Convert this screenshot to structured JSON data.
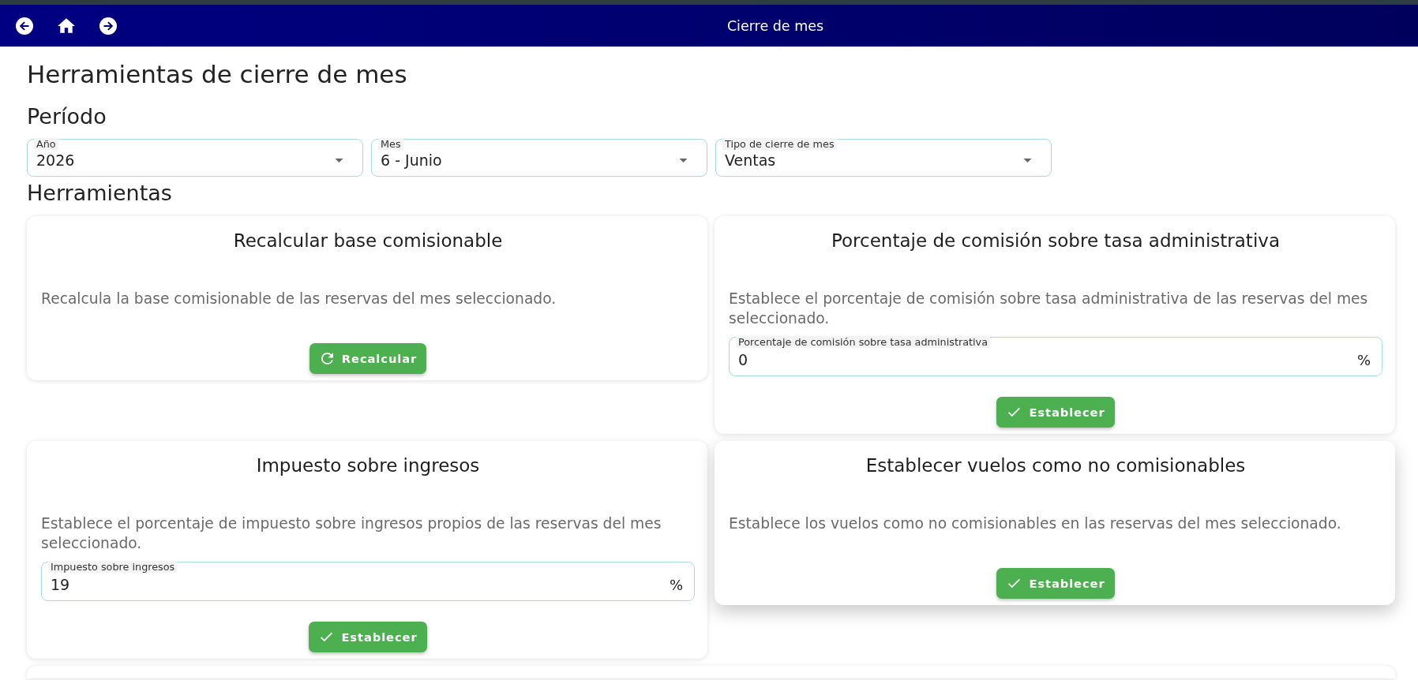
{
  "top_bar": {
    "title": "Cierre de mes"
  },
  "page_title": "Herramientas de cierre de mes",
  "period": {
    "title": "Período",
    "fields": [
      {
        "label": "Año",
        "value": "2026"
      },
      {
        "label": "Mes",
        "value": "6 - Junio"
      },
      {
        "label": "Tipo de cierre de mes",
        "value": "Ventas"
      }
    ]
  },
  "tools": {
    "title": "Herramientas",
    "cards": [
      {
        "title": "Recalcular base comisionable",
        "description": "Recalcula la base comisionable de las reservas del mes seleccionado.",
        "hovered": false,
        "button": {
          "label": "Recalcular",
          "kind": "recalculate"
        }
      },
      {
        "title": "Porcentaje de comisión sobre tasa administrativa",
        "description": "Establece el porcentaje de comisión sobre tasa administrativa de las reservas del mes seleccionado.",
        "hovered": false,
        "field": {
          "label": "Porcentaje de comisión sobre tasa administrativa",
          "value": "0",
          "suffix": "%"
        },
        "button": {
          "label": "Establecer",
          "kind": "apply"
        }
      },
      {
        "title": "Impuesto sobre ingresos",
        "description": "Establece el porcentaje de impuesto sobre ingresos propios de las reservas del mes seleccionado.",
        "hovered": false,
        "field": {
          "label": "Impuesto sobre ingresos",
          "value": "19",
          "suffix": "%"
        },
        "button": {
          "label": "Establecer",
          "kind": "apply"
        }
      },
      {
        "title": "Establecer vuelos como no comisionables",
        "description": "Establece los vuelos como no comisionables en las reservas del mes seleccionado.",
        "hovered": true,
        "button": {
          "label": "Establecer",
          "kind": "apply"
        }
      }
    ]
  }
}
